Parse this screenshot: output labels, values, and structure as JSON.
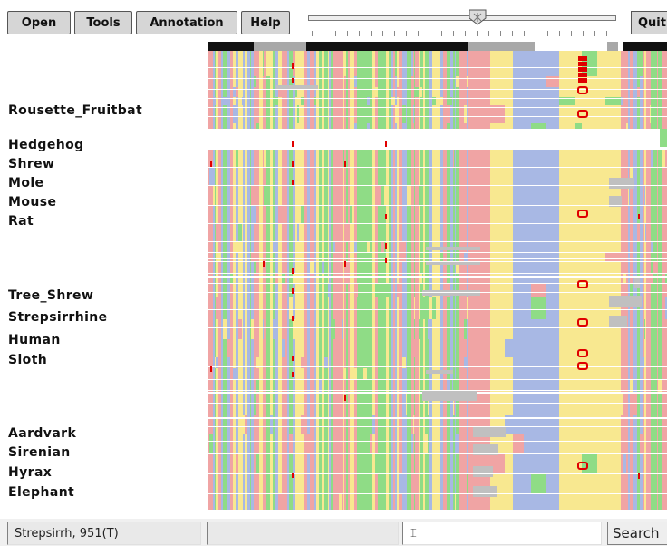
{
  "menu": {
    "open": "Open",
    "tools": "Tools",
    "annotation": "Annotation",
    "help": "Help",
    "quit": "Quit"
  },
  "zoom_slider": {
    "position_fraction": 0.55
  },
  "species": [
    "Rousette_Fruitbat",
    "Hedgehog",
    "Shrew",
    "Mole",
    "Mouse",
    "Rat",
    "Tree_Shrew",
    "Strepsirrhine",
    "Human",
    "Sloth",
    "Aardvark",
    "Sirenian",
    "Hyrax",
    "Elephant"
  ],
  "status": {
    "position": "Strepsirrh, 951(T)",
    "message": "",
    "search_value": "",
    "search_label": "Search"
  },
  "colors": {
    "A": "#8fdc86",
    "C": "#a8b8e4",
    "G": "#f8e890",
    "T": "#f0a4a4",
    "gap": "#c0c0c0",
    "separator": "#ffffff",
    "overview_dark": "#111111",
    "overview_gray": "#a8a8a8",
    "marker": "#e00000"
  }
}
